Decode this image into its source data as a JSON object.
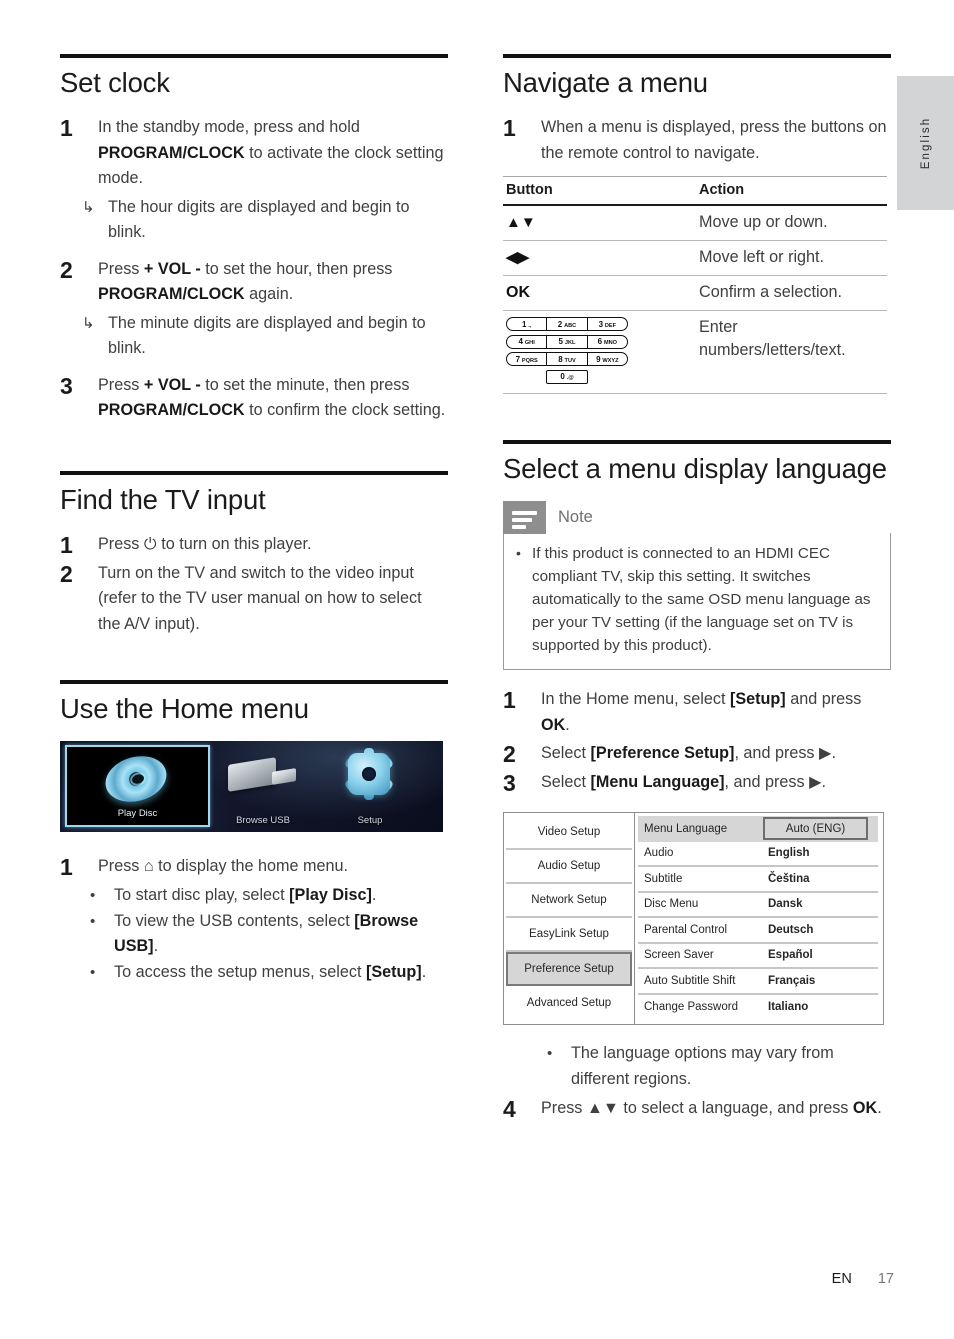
{
  "side_tab": {
    "label": "English"
  },
  "footer": {
    "lang_code": "EN",
    "page_number": "17"
  },
  "left_column": {
    "set_clock": {
      "heading": "Set clock",
      "steps": [
        {
          "num": "1",
          "text_parts": [
            {
              "t": "In the standby mode, press and hold ",
              "b": false
            },
            {
              "t": "PROGRAM/CLOCK",
              "b": true
            },
            {
              "t": " to activate the clock setting mode.",
              "b": false
            }
          ],
          "sub_arrow": "The hour digits are displayed and begin to blink."
        },
        {
          "num": "2",
          "text_parts": [
            {
              "t": "Press ",
              "b": false
            },
            {
              "t": "+ VOL -",
              "b": true
            },
            {
              "t": " to set the hour, then press ",
              "b": false
            },
            {
              "t": "PROGRAM/CLOCK",
              "b": true
            },
            {
              "t": " again.",
              "b": false
            }
          ],
          "sub_arrow": "The minute digits are displayed and begin to blink."
        },
        {
          "num": "3",
          "text_parts": [
            {
              "t": "Press ",
              "b": false
            },
            {
              "t": "+ VOL -",
              "b": true
            },
            {
              "t": " to set the minute, then press ",
              "b": false
            },
            {
              "t": "PROGRAM/CLOCK",
              "b": true
            },
            {
              "t": " to confirm the clock setting.",
              "b": false
            }
          ]
        }
      ]
    },
    "find_tv_input": {
      "heading": "Find the TV input",
      "steps": [
        {
          "num": "1",
          "text_parts": [
            {
              "t": "Press ",
              "b": false
            },
            {
              "t": "⏻",
              "b": false
            },
            {
              "t": " to turn on this player.",
              "b": false
            }
          ]
        },
        {
          "num": "2",
          "text_parts": [
            {
              "t": "Turn on the TV and switch to the video input (refer to the TV user manual on how to select the A/V input).",
              "b": false
            }
          ]
        }
      ]
    },
    "home_menu": {
      "heading": "Use the Home menu",
      "screenshot": {
        "tiles": [
          {
            "label": "Play Disc",
            "icon": "disc-icon",
            "selected": true
          },
          {
            "label": "Browse USB",
            "icon": "usb-icon",
            "selected": false
          },
          {
            "label": "Setup",
            "icon": "gear-icon",
            "selected": false
          }
        ]
      },
      "step": {
        "num": "1",
        "text_parts": [
          {
            "t": "Press ",
            "b": false
          },
          {
            "t": "⌂",
            "b": false
          },
          {
            "t": " to display the home menu.",
            "b": false
          }
        ],
        "bullets": [
          [
            {
              "t": "To start disc play, select ",
              "b": false
            },
            {
              "t": "[Play Disc]",
              "b": true
            },
            {
              "t": ".",
              "b": false
            }
          ],
          [
            {
              "t": "To view the USB contents, select ",
              "b": false
            },
            {
              "t": "[Browse USB]",
              "b": true
            },
            {
              "t": ".",
              "b": false
            }
          ],
          [
            {
              "t": "To access the setup menus, select ",
              "b": false
            },
            {
              "t": "[Setup]",
              "b": true
            },
            {
              "t": ".",
              "b": false
            }
          ]
        ]
      }
    }
  },
  "right_column": {
    "navigate_menu": {
      "heading": "Navigate a menu",
      "step": {
        "num": "1",
        "text": "When a menu is displayed, press the buttons on the remote control to navigate."
      },
      "table": {
        "headers": [
          "Button",
          "Action"
        ],
        "rows": [
          {
            "button": "▲▼",
            "action": "Move up or down.",
            "type": "glyph"
          },
          {
            "button": "◀▶",
            "action": "Move left or right.",
            "type": "glyph"
          },
          {
            "button": "OK",
            "action": "Confirm a selection.",
            "type": "text"
          },
          {
            "button": "keypad",
            "action": "Enter numbers/letters/text.",
            "type": "keypad"
          }
        ]
      },
      "keypad": {
        "rows": [
          [
            {
              "num": "1",
              "letters": ".,"
            },
            {
              "num": "2",
              "letters": "ABC"
            },
            {
              "num": "3",
              "letters": "DEF"
            }
          ],
          [
            {
              "num": "4",
              "letters": "GHI"
            },
            {
              "num": "5",
              "letters": "JKL"
            },
            {
              "num": "6",
              "letters": "MNO"
            }
          ],
          [
            {
              "num": "7",
              "letters": "PQRS"
            },
            {
              "num": "8",
              "letters": "TUV"
            },
            {
              "num": "9",
              "letters": "WXYZ"
            }
          ]
        ],
        "zero_key": {
          "num": "0",
          "letters": ".@"
        }
      }
    },
    "select_language": {
      "heading": "Select a menu display language",
      "note": {
        "title": "Note",
        "items": [
          "If this product is connected to an HDMI CEC compliant TV, skip this setting. It switches automatically to the same OSD menu language as per your TV setting (if the language set on TV is supported by this product)."
        ]
      },
      "steps": [
        {
          "num": "1",
          "text_parts": [
            {
              "t": "In the Home menu, select ",
              "b": false
            },
            {
              "t": "[Setup]",
              "b": true
            },
            {
              "t": " and press ",
              "b": false
            },
            {
              "t": "OK",
              "b": true
            },
            {
              "t": ".",
              "b": false
            }
          ]
        },
        {
          "num": "2",
          "text_parts": [
            {
              "t": "Select ",
              "b": false
            },
            {
              "t": "[Preference Setup]",
              "b": true
            },
            {
              "t": ", and press ▶.",
              "b": false
            }
          ]
        },
        {
          "num": "3",
          "text_parts": [
            {
              "t": "Select ",
              "b": false
            },
            {
              "t": "[Menu Language]",
              "b": true
            },
            {
              "t": ", and press ▶.",
              "b": false
            }
          ]
        }
      ],
      "setup_screenshot": {
        "left_menu": [
          {
            "label": "Video Setup",
            "selected": false
          },
          {
            "label": "Audio Setup",
            "selected": false
          },
          {
            "label": "Network Setup",
            "selected": false
          },
          {
            "label": "EasyLink Setup",
            "selected": false
          },
          {
            "label": "Preference Setup",
            "selected": true
          },
          {
            "label": "Advanced Setup",
            "selected": false
          }
        ],
        "right_rows": [
          {
            "name": "Menu Language",
            "value": "Auto (ENG)",
            "selected": true
          },
          {
            "name": "Audio",
            "value": "English",
            "selected": false
          },
          {
            "name": "Subtitle",
            "value": "Čeština",
            "selected": false
          },
          {
            "name": "Disc Menu",
            "value": "Dansk",
            "selected": false
          },
          {
            "name": "Parental Control",
            "value": "Deutsch",
            "selected": false
          },
          {
            "name": "Screen Saver",
            "value": "Español",
            "selected": false
          },
          {
            "name": "Auto Subtitle Shift",
            "value": "Français",
            "selected": false
          },
          {
            "name": "Change Password",
            "value": "Italiano",
            "selected": false
          }
        ]
      },
      "trailing_bullet": "The language options may vary from different regions.",
      "step4": {
        "num": "4",
        "text_parts": [
          {
            "t": "Press ▲▼ to select a language, and press ",
            "b": false
          },
          {
            "t": "OK",
            "b": true
          },
          {
            "t": ".",
            "b": false
          }
        ]
      }
    }
  }
}
